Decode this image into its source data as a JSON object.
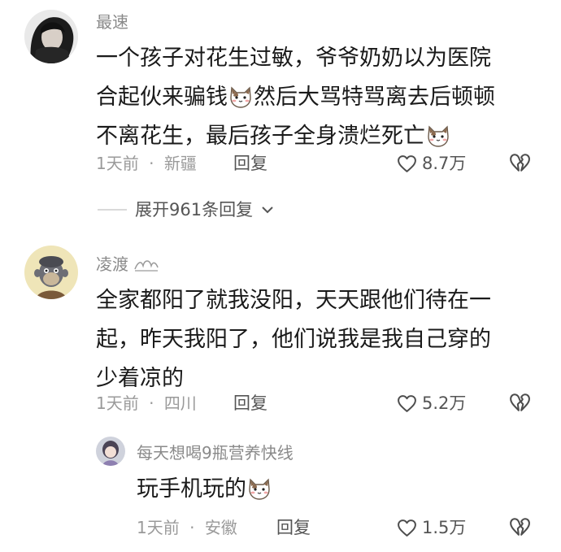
{
  "comments": [
    {
      "username": "最速",
      "content_parts": [
        "一个孩子对花生过敏，爷爷奶奶以为医院",
        "合起伙来骗钱",
        "然后大骂特骂离去后顿顿",
        "不离花生，最后孩子全身溃烂死亡"
      ],
      "time": "1天前",
      "location": "新疆",
      "reply_label": "回复",
      "likes": "8.7万",
      "expand_label": "展开961条回复"
    },
    {
      "username": "凌渡",
      "content_lines": [
        "全家都阳了就我没阳，天天跟他们待在一",
        "起，昨天我阳了，他们说我是我自己穿的",
        "少着凉的"
      ],
      "time": "1天前",
      "location": "四川",
      "reply_label": "回复",
      "likes": "5.2万"
    },
    {
      "username": "每天想喝9瓶营养快线",
      "content": "玩手机玩的",
      "time": "1天前",
      "location": "安徽",
      "reply_label": "回复",
      "likes": "1.5万"
    }
  ],
  "meta_separator": "·",
  "icons": {
    "emoji": "cat-face-emoji",
    "like": "heart-outline-icon",
    "dislike": "broken-heart-icon",
    "expand": "chevron-down-icon",
    "badge": "wave-badge-icon"
  },
  "colors": {
    "text_primary": "#1a1a1a",
    "text_secondary": "#8a8a8a",
    "text_meta": "#9a9a9a"
  }
}
